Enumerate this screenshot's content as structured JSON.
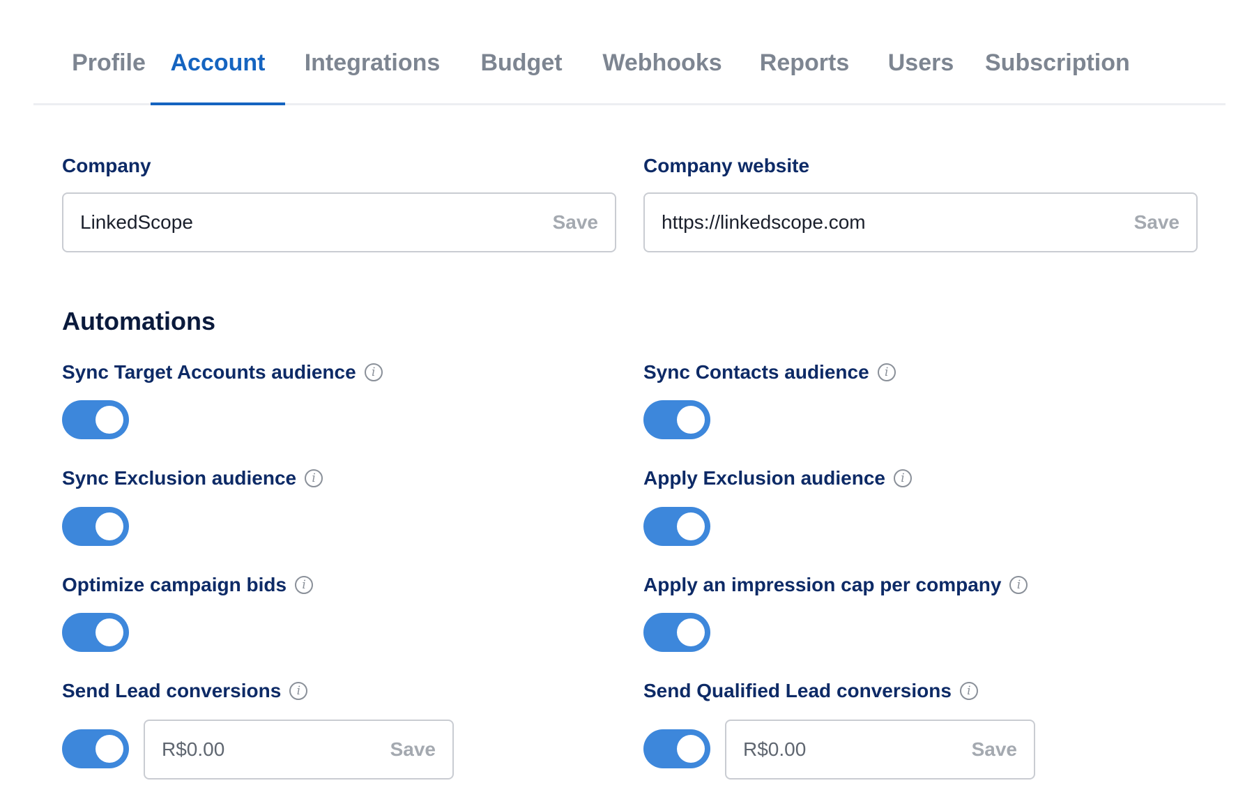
{
  "tabs": [
    {
      "label": "Profile",
      "active": false
    },
    {
      "label": "Account",
      "active": true
    },
    {
      "label": "Integrations",
      "active": false
    },
    {
      "label": "Budget",
      "active": false
    },
    {
      "label": "Webhooks",
      "active": false
    },
    {
      "label": "Reports",
      "active": false
    },
    {
      "label": "Users",
      "active": false
    },
    {
      "label": "Subscription",
      "active": false
    }
  ],
  "company": {
    "label": "Company",
    "value": "LinkedScope",
    "save_label": "Save"
  },
  "website": {
    "label": "Company website",
    "value": "https://linkedscope.com",
    "save_label": "Save"
  },
  "automations": {
    "title": "Automations",
    "items": [
      {
        "label": "Sync Target Accounts audience",
        "enabled": true
      },
      {
        "label": "Sync Contacts audience",
        "enabled": true
      },
      {
        "label": "Sync Exclusion audience",
        "enabled": true
      },
      {
        "label": "Apply Exclusion audience",
        "enabled": true
      },
      {
        "label": "Optimize campaign bids",
        "enabled": true
      },
      {
        "label": "Apply an impression cap per company",
        "enabled": true
      },
      {
        "label": "Send Lead conversions",
        "enabled": true,
        "value": "R$0.00",
        "save_label": "Save"
      },
      {
        "label": "Send Qualified Lead conversions",
        "enabled": true,
        "value": "R$0.00",
        "save_label": "Save"
      }
    ]
  },
  "colors": {
    "accent": "#1564c0",
    "toggle_on": "#3d87db",
    "label": "#0d2a66",
    "tab_inactive": "#7d8591"
  },
  "icons": {
    "info": "info-icon"
  }
}
